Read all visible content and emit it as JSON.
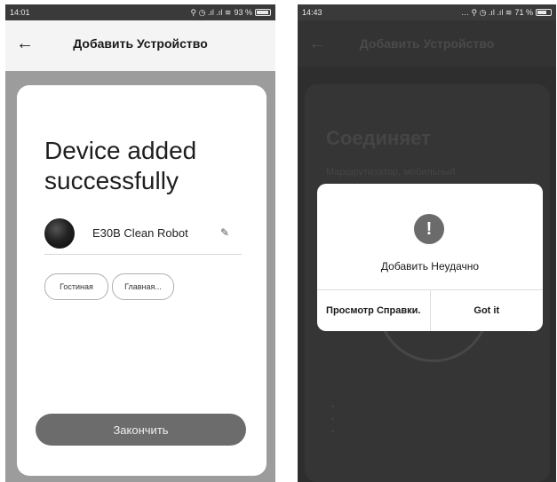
{
  "left": {
    "status": {
      "time": "14:01",
      "battery": "93 %"
    },
    "header": {
      "back": "←",
      "title": "Добавить Устройство"
    },
    "card": {
      "title_line1": "Device added",
      "title_line2": "successfully",
      "device_name": "E30B Clean Robot",
      "edit_glyph": "✎",
      "rooms": [
        "Гостиная",
        "Главная..."
      ],
      "finish_label": "Закончить"
    }
  },
  "right": {
    "status": {
      "time": "14:43",
      "battery": "71 %"
    },
    "header": {
      "back": "←",
      "title": "Добавить Устройство"
    },
    "background": {
      "title": "Соединяет",
      "subtitle": "Маршрутизатор, мобильный"
    },
    "dialog": {
      "icon": "!",
      "message": "Добавить Неудачно",
      "help_label": "Просмотр Справки.",
      "ok_label": "Got it"
    }
  }
}
